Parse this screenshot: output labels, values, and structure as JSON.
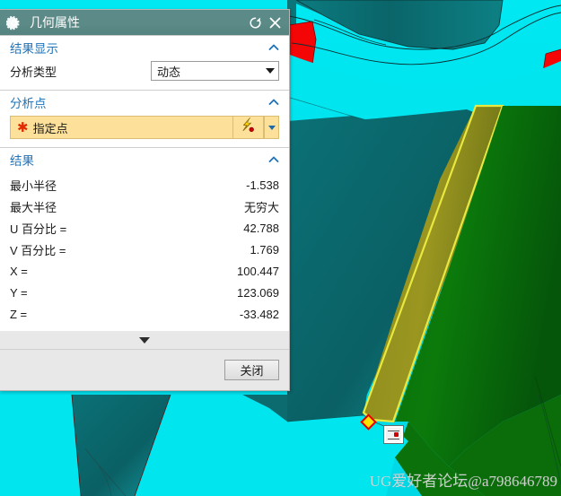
{
  "window": {
    "title": "几何属性",
    "icon": "gear-icon",
    "reset_icon": "reset-icon",
    "close_icon": "close-icon"
  },
  "groups": {
    "result_display": {
      "title": "结果显示",
      "collapse_icon": "chevron-up-icon",
      "analysis_type_label": "分析类型",
      "analysis_type_value": "动态",
      "analysis_type_options": [
        "动态"
      ]
    },
    "analysis_point": {
      "title": "分析点",
      "collapse_icon": "chevron-up-icon",
      "required_marker": "✱",
      "point_placeholder": "指定点",
      "point_button_icon": "point-constructor-icon",
      "point_dropdown_icon": "caret-down-icon"
    },
    "result": {
      "title": "结果",
      "collapse_icon": "chevron-up-icon",
      "rows": [
        {
          "label": "最小半径",
          "value": "-1.538"
        },
        {
          "label": "最大半径",
          "value": "无穷大"
        },
        {
          "label": "U 百分比 =",
          "value": "42.788"
        },
        {
          "label": "V 百分比 =",
          "value": "1.769"
        },
        {
          "label": "X =",
          "value": "100.447"
        },
        {
          "label": "Y =",
          "value": "123.069"
        },
        {
          "label": "Z =",
          "value": "-33.482"
        }
      ]
    }
  },
  "expander": {
    "icon": "chevron-down-icon"
  },
  "footer": {
    "close_label": "关闭"
  },
  "viewport": {
    "watermark": "UG爱好者论坛@a798646789",
    "point_marker": "selected-point-marker",
    "cursor_glyph": "snap-point-cursor-icon",
    "colors": {
      "cyan": "#00e5ee",
      "teal": "#0a6a6e",
      "red": "#f00000",
      "olive": "#8f8c1b",
      "dark_green": "#0a6b0a",
      "edge_yellow": "#e8e840"
    }
  }
}
